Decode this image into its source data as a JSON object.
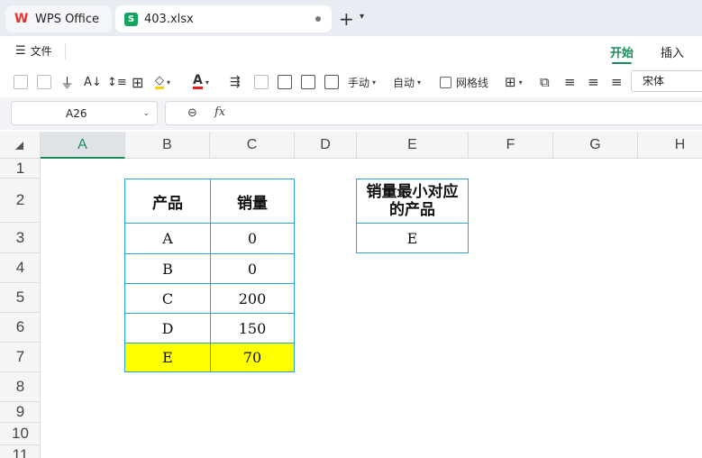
{
  "tabs": {
    "app": "WPS Office",
    "file": "403.xlsx"
  },
  "menu": {
    "file": "文件",
    "home": "开始",
    "insert": "插入"
  },
  "toolbar": {
    "manual": "手动",
    "auto": "自动",
    "gridlines": "网格线",
    "font": "宋体"
  },
  "formula": {
    "cell_ref": "A26",
    "fx": "fx",
    "value": ""
  },
  "sheet": {
    "columns": [
      "A",
      "B",
      "C",
      "D",
      "E",
      "F",
      "G",
      "H"
    ],
    "rows": [
      "1",
      "2",
      "3",
      "4",
      "5",
      "6",
      "7",
      "8",
      "9",
      "10",
      "11"
    ],
    "table": {
      "headers": [
        "产品",
        "销量"
      ],
      "rows": [
        [
          "A",
          "0"
        ],
        [
          "B",
          "0"
        ],
        [
          "C",
          "200"
        ],
        [
          "D",
          "150"
        ],
        [
          "E",
          "70"
        ]
      ]
    },
    "result": {
      "header": "销量最小对应的产品",
      "value": "E"
    },
    "highlight_color": "#ffff00",
    "border_color": "#2aa2d6"
  }
}
